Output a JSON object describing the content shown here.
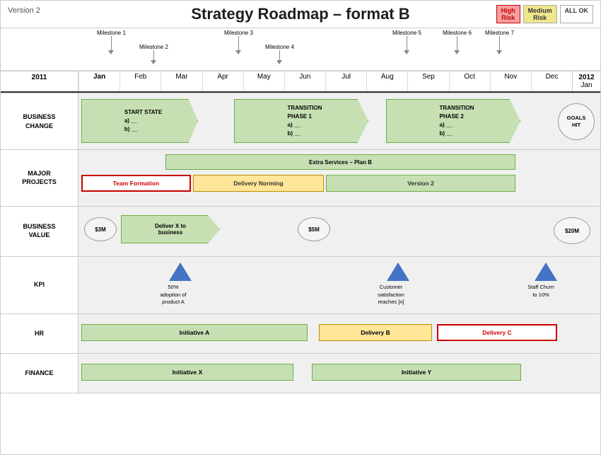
{
  "header": {
    "version": "Version 2",
    "title": "Strategy Roadmap – format B",
    "legend": {
      "high_risk": "High\nRisk",
      "medium_risk": "Medium\nRisk",
      "all_ok": "ALL OK"
    }
  },
  "timeline": {
    "year_left": "2011",
    "year_right": "2012",
    "months": [
      "Jan",
      "Feb",
      "Mar",
      "Apr",
      "May",
      "Jun",
      "Jul",
      "Aug",
      "Sep",
      "Oct",
      "Nov",
      "Dec",
      "Jan"
    ]
  },
  "milestones": [
    {
      "label": "Milestone 1",
      "col": 0
    },
    {
      "label": "Milestone 2",
      "col": 1
    },
    {
      "label": "Milestone 3",
      "col": 2
    },
    {
      "label": "Milestone 4",
      "col": 3
    },
    {
      "label": "Milestone 5",
      "col": 5
    },
    {
      "label": "Milestone 6",
      "col": 6
    },
    {
      "label": "Milestone 7",
      "col": 7
    }
  ],
  "sections": {
    "business_change": {
      "label": "BUSINESS\nCHANGE",
      "start_state": "START STATE\na)  __\nb)  __",
      "transition1": "TRANSITION\nPHASE 1\na)  __\nb) __",
      "transition2": "TRANSITION\nPHASE 2\na)  __\nb) __",
      "goals": "GOALS\nHIT"
    },
    "major_projects": {
      "label": "MAJOR\nPROJECTS",
      "items": [
        {
          "name": "Extra Services – Plan B",
          "color": "#c6e0b4",
          "border": "#70ad47"
        },
        {
          "name": "Team Formation",
          "color": "#fff",
          "border": "#c00",
          "text_color": "#c00"
        },
        {
          "name": "Delivery Norming",
          "color": "#ffe699",
          "border": "#bf8f00"
        },
        {
          "name": "Version 2",
          "color": "#c6e0b4",
          "border": "#70ad47"
        }
      ]
    },
    "business_value": {
      "label": "BUSINESS\nVALUE",
      "items": [
        {
          "name": "$3M",
          "type": "oval"
        },
        {
          "name": "Deliver X to\nbusiness",
          "type": "chevron",
          "color": "#c6e0b4"
        },
        {
          "name": "$5M",
          "type": "oval"
        },
        {
          "name": "$20M",
          "type": "oval"
        }
      ]
    },
    "kpi": {
      "label": "KPI",
      "items": [
        {
          "label": "50%\nadoption of\nproduct A"
        },
        {
          "label": "Customer\nsatisfaction\nreaches [n]"
        },
        {
          "label": "Staff Churn\nto 10%"
        }
      ]
    },
    "hr": {
      "label": "HR",
      "items": [
        {
          "name": "Initiative A",
          "color": "#c6e0b4",
          "border": "#70ad47"
        },
        {
          "name": "Delivery B",
          "color": "#ffe699",
          "border": "#bf8f00"
        },
        {
          "name": "Delivery C",
          "color": "#fff",
          "border": "#c00",
          "text_color": "#c00"
        }
      ]
    },
    "finance": {
      "label": "FINANCE",
      "items": [
        {
          "name": "Initiative X",
          "color": "#c6e0b4",
          "border": "#70ad47"
        },
        {
          "name": "Initiative Y",
          "color": "#c6e0b4",
          "border": "#70ad47"
        }
      ]
    }
  }
}
